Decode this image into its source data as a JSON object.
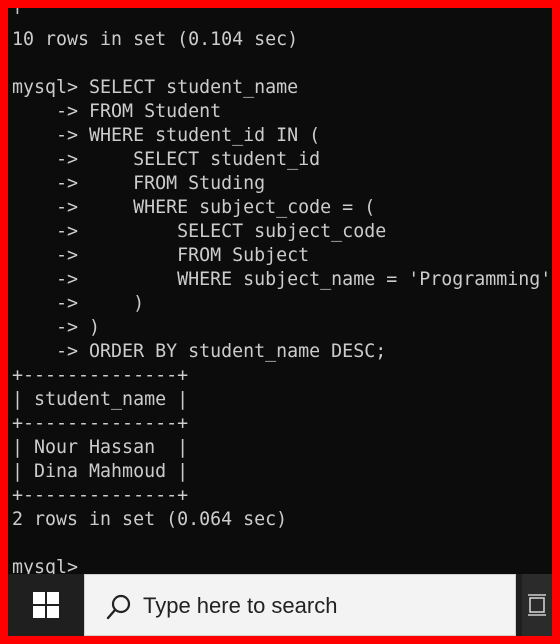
{
  "terminal": {
    "lines": [
      "10 rows in set (0.104 sec)",
      "",
      "mysql> SELECT student_name",
      "    -> FROM Student",
      "    -> WHERE student_id IN (",
      "    ->     SELECT student_id",
      "    ->     FROM Studing",
      "    ->     WHERE subject_code = (",
      "    ->         SELECT subject_code",
      "    ->         FROM Subject",
      "    ->         WHERE subject_name = 'Programming'",
      "    ->     )",
      "    -> )",
      "    -> ORDER BY student_name DESC;",
      "+--------------+",
      "| student_name |",
      "+--------------+",
      "| Nour Hassan  |",
      "| Dina Mahmoud |",
      "+--------------+",
      "2 rows in set (0.064 sec)",
      "",
      "mysql>"
    ],
    "text_color": "#cccccc",
    "background_color": "#0c0c0c"
  },
  "taskbar": {
    "start_icon": "windows-logo-icon",
    "search": {
      "icon": "search-icon",
      "placeholder": "Type here to search"
    },
    "taskview_icon": "task-view-icon"
  },
  "frame_color": "#ff0000"
}
